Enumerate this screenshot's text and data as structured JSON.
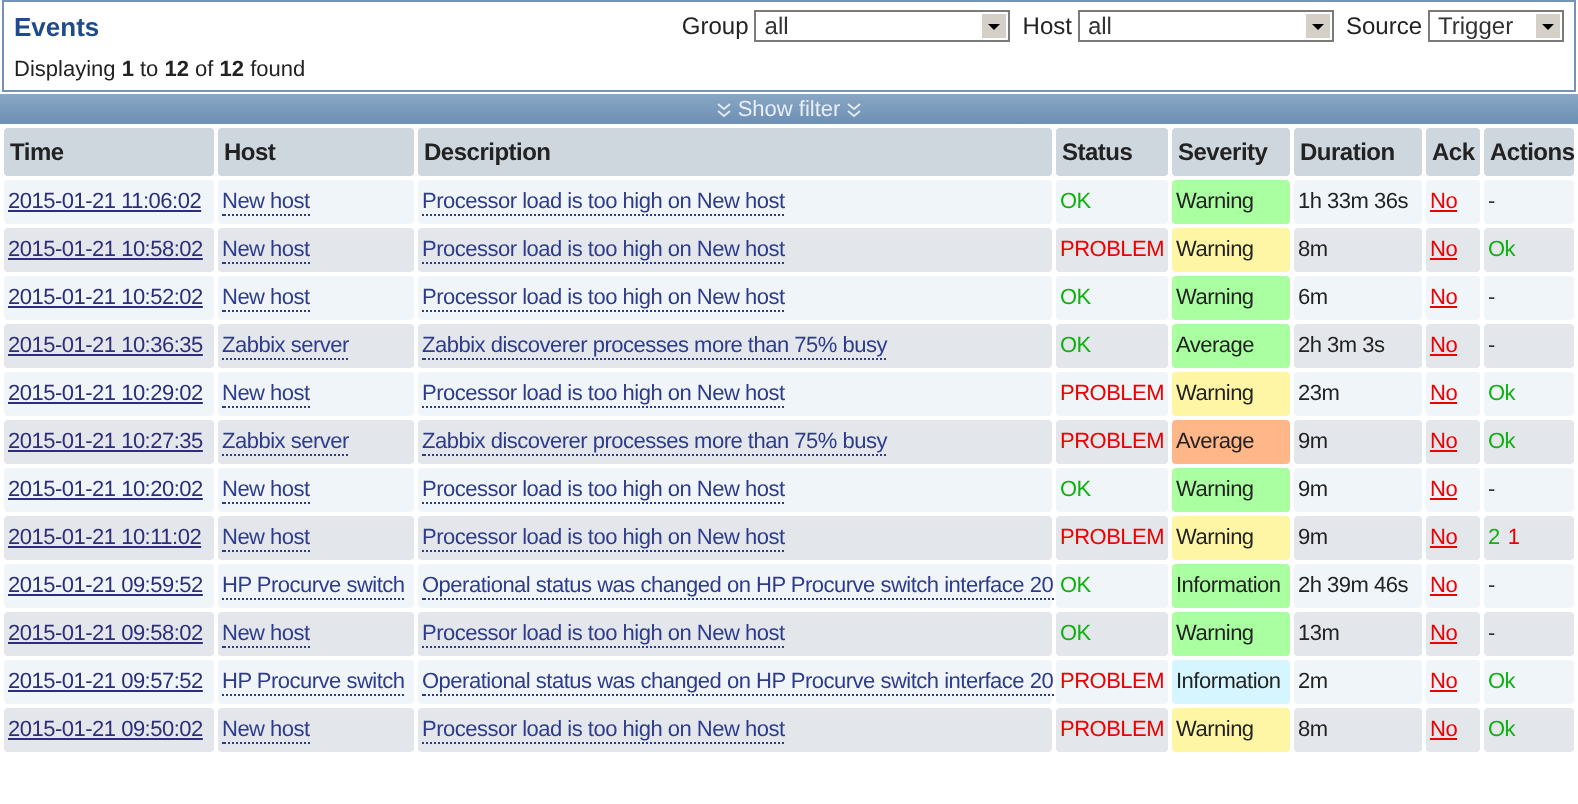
{
  "header": {
    "title": "Events",
    "summary": "Displaying **1** to **12** of **12** found",
    "filters": [
      {
        "label": "Group",
        "value": "all"
      },
      {
        "label": "Host",
        "value": "all"
      },
      {
        "label": "Source",
        "value": "Trigger"
      }
    ]
  },
  "filter_bar": {
    "label": "Show filter"
  },
  "table": {
    "columns": [
      "Time",
      "Host",
      "Description",
      "Status",
      "Severity",
      "Duration",
      "Ack",
      "Actions"
    ],
    "rows": [
      {
        "time": "2015-01-21 11:06:02",
        "host": "New host",
        "description": "Processor load is too high on New host",
        "status": "OK",
        "problem": false,
        "severity": "Warning",
        "color": "#aaffa0",
        "duration": "1h 33m 36s",
        "ack": "No",
        "actions": [
          {
            "text": "-",
            "kind": "none"
          }
        ]
      },
      {
        "time": "2015-01-21 10:58:02",
        "host": "New host",
        "description": "Processor load is too high on New host",
        "status": "PROBLEM",
        "problem": true,
        "severity": "Warning",
        "color": "#fff6a5",
        "duration": "8m",
        "ack": "No",
        "actions": [
          {
            "text": "Ok",
            "kind": "ok"
          }
        ]
      },
      {
        "time": "2015-01-21 10:52:02",
        "host": "New host",
        "description": "Processor load is too high on New host",
        "status": "OK",
        "problem": false,
        "severity": "Warning",
        "color": "#aaffa0",
        "duration": "6m",
        "ack": "No",
        "actions": [
          {
            "text": "-",
            "kind": "none"
          }
        ]
      },
      {
        "time": "2015-01-21 10:36:35",
        "host": "Zabbix server",
        "description": "Zabbix discoverer processes more than 75% busy",
        "status": "OK",
        "problem": false,
        "severity": "Average",
        "color": "#aaffa0",
        "duration": "2h 3m 3s",
        "ack": "No",
        "actions": [
          {
            "text": "-",
            "kind": "none"
          }
        ]
      },
      {
        "time": "2015-01-21 10:29:02",
        "host": "New host",
        "description": "Processor load is too high on New host",
        "status": "PROBLEM",
        "problem": true,
        "severity": "Warning",
        "color": "#fff6a5",
        "duration": "23m",
        "ack": "No",
        "actions": [
          {
            "text": "Ok",
            "kind": "ok"
          }
        ]
      },
      {
        "time": "2015-01-21 10:27:35",
        "host": "Zabbix server",
        "description": "Zabbix discoverer processes more than 75% busy",
        "status": "PROBLEM",
        "problem": true,
        "severity": "Average",
        "color": "#ffb689",
        "duration": "9m",
        "ack": "No",
        "actions": [
          {
            "text": "Ok",
            "kind": "ok"
          }
        ]
      },
      {
        "time": "2015-01-21 10:20:02",
        "host": "New host",
        "description": "Processor load is too high on New host",
        "status": "OK",
        "problem": false,
        "severity": "Warning",
        "color": "#aaffa0",
        "duration": "9m",
        "ack": "No",
        "actions": [
          {
            "text": "-",
            "kind": "none"
          }
        ]
      },
      {
        "time": "2015-01-21 10:11:02",
        "host": "New host",
        "description": "Processor load is too high on New host",
        "status": "PROBLEM",
        "problem": true,
        "severity": "Warning",
        "color": "#fff6a5",
        "duration": "9m",
        "ack": "No",
        "actions": [
          {
            "text": "2",
            "kind": "ok"
          },
          {
            "text": "1",
            "kind": "failed"
          }
        ]
      },
      {
        "time": "2015-01-21 09:59:52",
        "host": "HP Procurve switch",
        "description": "Operational status was changed on HP Procurve switch interface 20",
        "status": "OK",
        "problem": false,
        "severity": "Information",
        "color": "#aaffa0",
        "duration": "2h 39m 46s",
        "ack": "No",
        "actions": [
          {
            "text": "-",
            "kind": "none"
          }
        ]
      },
      {
        "time": "2015-01-21 09:58:02",
        "host": "New host",
        "description": "Processor load is too high on New host",
        "status": "OK",
        "problem": false,
        "severity": "Warning",
        "color": "#aaffa0",
        "duration": "13m",
        "ack": "No",
        "actions": [
          {
            "text": "-",
            "kind": "none"
          }
        ]
      },
      {
        "time": "2015-01-21 09:57:52",
        "host": "HP Procurve switch",
        "description": "Operational status was changed on HP Procurve switch interface 20",
        "status": "PROBLEM",
        "problem": true,
        "severity": "Information",
        "color": "#d6f6ff",
        "duration": "2m",
        "ack": "No",
        "actions": [
          {
            "text": "Ok",
            "kind": "ok"
          }
        ]
      },
      {
        "time": "2015-01-21 09:50:02",
        "host": "New host",
        "description": "Processor load is too high on New host",
        "status": "PROBLEM",
        "problem": true,
        "severity": "Warning",
        "color": "#fff6a5",
        "duration": "8m",
        "ack": "No",
        "actions": [
          {
            "text": "Ok",
            "kind": "ok"
          }
        ]
      }
    ]
  }
}
